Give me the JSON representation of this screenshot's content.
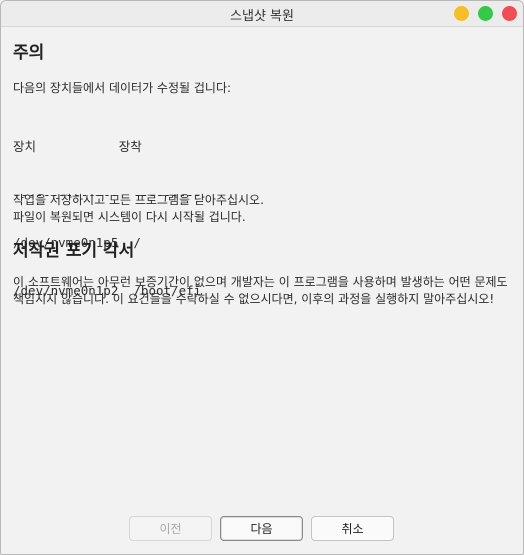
{
  "window": {
    "title": "스냅샷 복원",
    "controls": [
      "minimize",
      "maximize",
      "close"
    ],
    "colors": {
      "minimize": "#f6bf2a",
      "maximize": "#37c84a",
      "close": "#ef4e57"
    }
  },
  "warning": {
    "heading": "주의",
    "lead": "다음의 장치들에서 데이터가 수정될 겁니다:",
    "table": {
      "header": "장치           장착",
      "divider": "--------------  ---------",
      "rows": [
        "/dev/nvme0n1p5  /",
        "/dev/nvme0n1p2  /boot/efi"
      ]
    },
    "note_line1": "작업을 저장하시고 모든 프로그램을 닫아주십시오.",
    "note_line2": "파일이 복원되면 시스템이 다시 시작될 겁니다."
  },
  "disclaimer": {
    "heading": "저작권 포기 각서",
    "text": "이 소프트웨어는 아무런 보증기간이 없으며 개발자는 이 프로그램을 사용하며 발생하는 어떤 문제도 책임지지 않습니다. 이 요건들을 수락하실 수 없으시다면, 이후의 과정을 실행하지 말아주십시오!"
  },
  "buttons": {
    "prev": "이전",
    "next": "다음",
    "cancel": "취소"
  }
}
